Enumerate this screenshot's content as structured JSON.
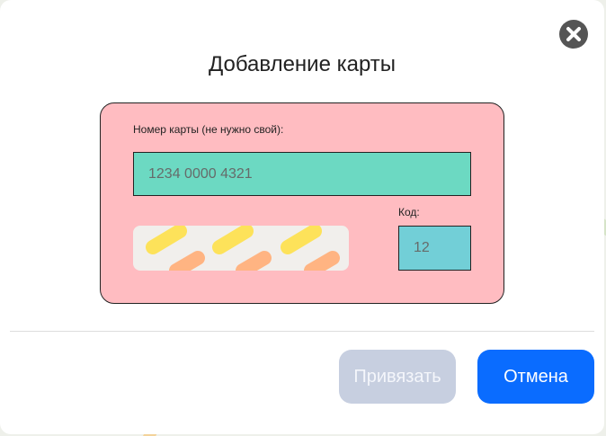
{
  "dialog": {
    "title": "Добавление карты",
    "close_icon": "close-icon"
  },
  "card": {
    "number_label": "Номер карты (не нужно свой):",
    "number_placeholder": "1234 0000 4321",
    "number_value": "",
    "code_label": "Код:",
    "code_placeholder": "12",
    "code_value": "",
    "colors": {
      "card_bg": "#ffbcc1",
      "number_field": "#6cd9c2",
      "code_field": "#72cfd7",
      "stripe_yellow": "#fde25a",
      "stripe_orange": "#ffb482"
    }
  },
  "actions": {
    "bind_label": "Привязать",
    "bind_disabled": true,
    "cancel_label": "Отмена",
    "accent": "#0a6cff"
  }
}
